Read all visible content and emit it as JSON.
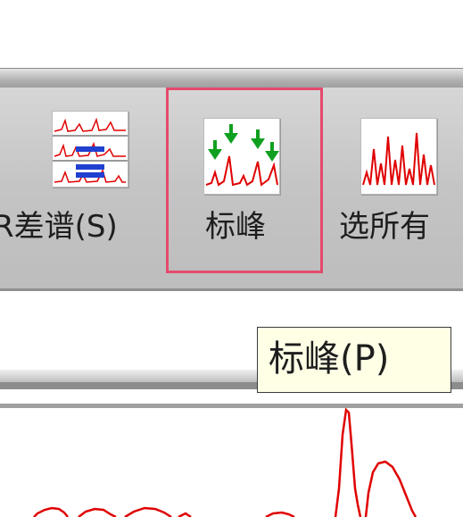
{
  "toolbar": {
    "buttons": [
      {
        "id": "subtract",
        "label": "R差谱(S)"
      },
      {
        "id": "mark-peaks",
        "label": "标峰"
      },
      {
        "id": "select-all",
        "label": "选所有"
      }
    ]
  },
  "tooltip": {
    "text": "标峰(P)"
  },
  "colors": {
    "spectrum_line": "#e00000",
    "highlight_border": "#e44a6c",
    "peak_arrow": "#10a020",
    "tooltip_bg": "#ffffe6"
  },
  "icons": [
    "subtract-spectrum-icon",
    "mark-peaks-icon",
    "select-all-icon"
  ]
}
